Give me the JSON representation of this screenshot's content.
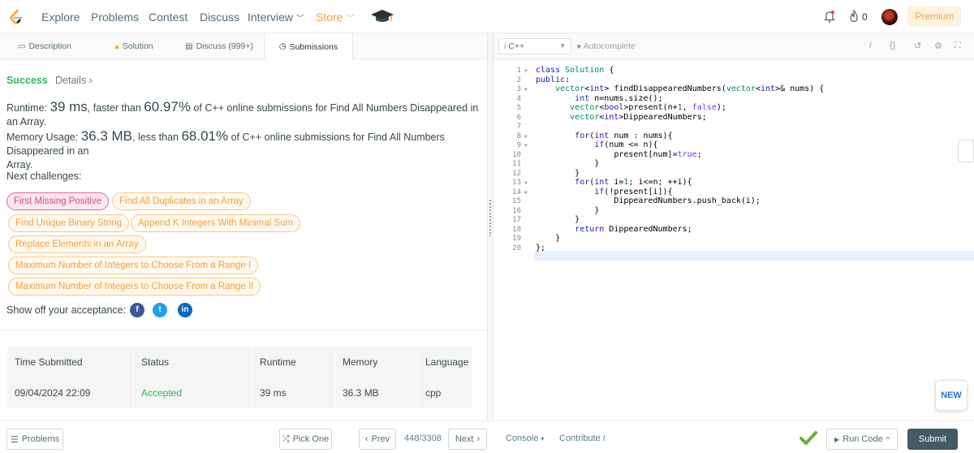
{
  "nav": {
    "items": [
      "Explore",
      "Problems",
      "Contest",
      "Discuss",
      "Interview",
      "Store"
    ],
    "fire_count": "0",
    "premium": "Premium"
  },
  "left_tabs": [
    "Description",
    "Solution",
    "Discuss (999+)",
    "Submissions"
  ],
  "result": {
    "status": "Success",
    "details": "Details ›",
    "runtime_prefix": "Runtime: ",
    "runtime_value": "39 ms",
    "runtime_mid": ", faster than ",
    "runtime_pct": "60.97%",
    "runtime_suffix": " of C++ online submissions for Find All Numbers Disappeared in an Array.",
    "memory_prefix": "Memory Usage: ",
    "memory_value": "36.3 MB",
    "memory_mid": ", less than ",
    "memory_pct": "68.01%",
    "memory_suffix": " of C++ online submissions for Find All Numbers Disappeared in an",
    "memory_suffix2": "Array."
  },
  "next_challenges_label": "Next challenges:",
  "challenges": [
    "First Missing Positive",
    "Find All Duplicates in an Array",
    "Find Unique Binary String",
    "Append K Integers With Minimal Sum",
    "Replace Elements in an Array",
    "Maximum Number of Integers to Choose From a Range I",
    "Maximum Number of Integers to Choose From a Range II"
  ],
  "show_off_label": "Show off your acceptance:",
  "social": [
    "f",
    "t",
    "in"
  ],
  "table": {
    "headers": [
      "Time Submitted",
      "Status",
      "Runtime",
      "Memory",
      "Language"
    ],
    "rows": [
      [
        "09/04/2024 22:09",
        "Accepted",
        "39 ms",
        "36.3 MB",
        "cpp"
      ]
    ]
  },
  "editor": {
    "language": "C++",
    "language_icon": "i",
    "autocomplete": "Autocomplete",
    "line_numbers": [
      "1",
      "2",
      "3",
      "4",
      "5",
      "6",
      "7",
      "8",
      "9",
      "10",
      "11",
      "12",
      "13",
      "14",
      "15",
      "16",
      "17",
      "18",
      "19",
      "20"
    ]
  },
  "bottom": {
    "problems": "Problems",
    "pick_one": "Pick One",
    "prev": "Prev",
    "counter": "448/3308",
    "next": "Next",
    "console": "Console",
    "contribute": "Contribute",
    "run_code": "Run Code",
    "submit": "Submit"
  },
  "new_badge": "NEW",
  "colors": {
    "success": "#2db55d",
    "accent": "#ff9f43",
    "submit_bg": "#455a64"
  }
}
